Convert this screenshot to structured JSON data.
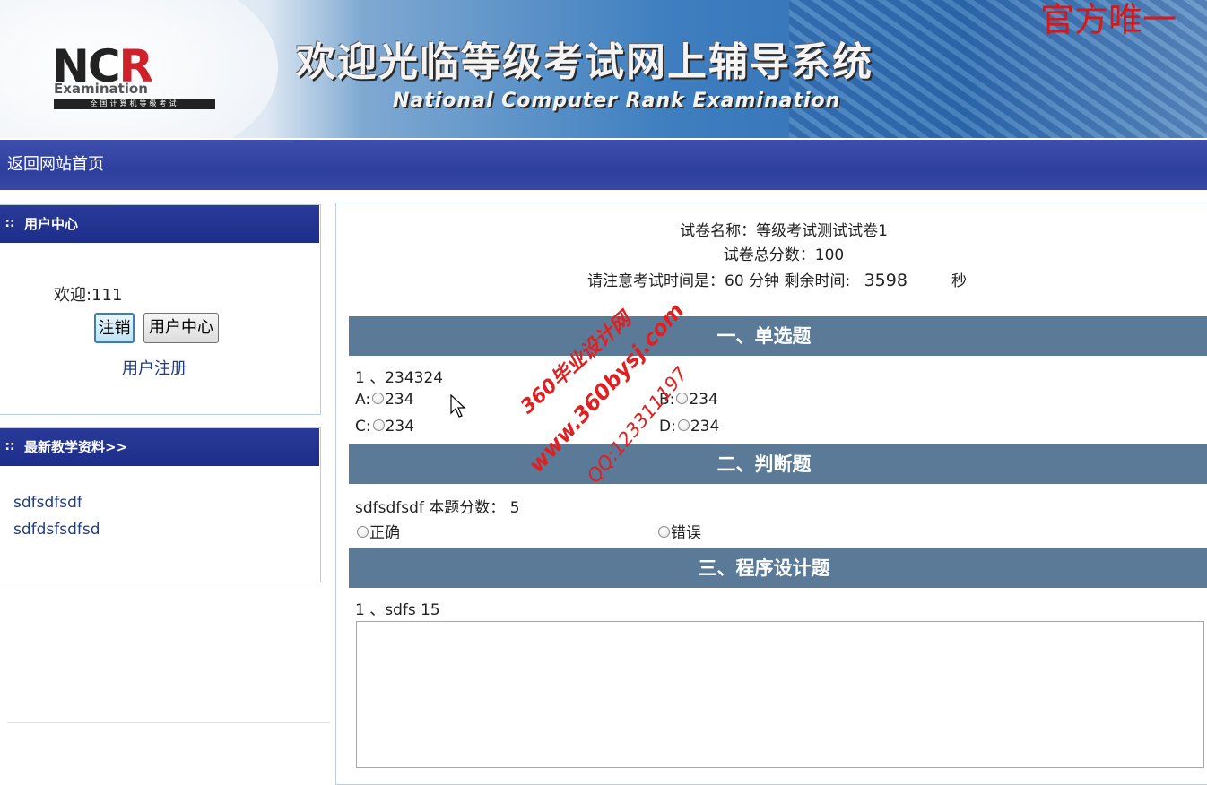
{
  "banner": {
    "logo_letters": "NCR",
    "logo_sub": "Examination",
    "logo_strip": "全国计算机等级考试",
    "title": "欢迎光临等级考试网上辅导系统",
    "subtitle": "National Computer Rank Examination",
    "official": "官方唯一"
  },
  "nav": {
    "home": "返回网站首页"
  },
  "user_panel": {
    "title": "用户中心",
    "welcome": "欢迎:111",
    "logout": "注销",
    "user_center": "用户中心",
    "register": "用户注册"
  },
  "resource_panel": {
    "title": "最新教学资料>>",
    "items": [
      "sdfsdfsdf",
      "sdfdsfsdfsd"
    ]
  },
  "exam": {
    "name_line": "试卷名称：等级考试测试试卷1",
    "total_line": "试卷总分数：100",
    "time_label": "请注意考试时间是：60 分钟  剩余时间:",
    "remaining": "3598",
    "unit": "秒"
  },
  "section1": {
    "title": "一、单选题",
    "question": "1 、234324",
    "options": [
      {
        "label": "A:",
        "text": "234"
      },
      {
        "label": "B:",
        "text": "234"
      },
      {
        "label": "C:",
        "text": "234"
      },
      {
        "label": "D:",
        "text": "234"
      }
    ]
  },
  "section2": {
    "title": "二、判断题",
    "question": "sdfsdfsdf 本题分数： 5",
    "true_label": "正确",
    "false_label": "错误"
  },
  "section3": {
    "title": "三、程序设计题",
    "question": "1 、sdfs 15",
    "answer": ""
  },
  "watermark": {
    "line1": "360毕业设计网",
    "line2": "www.360bysj.com",
    "line3": "QQ:123311197"
  },
  "colors": {
    "nav": "#2e3f9e",
    "panel_head": "#1d2d8a",
    "section_bar": "#5a7a98",
    "watermark": "#e02020"
  }
}
